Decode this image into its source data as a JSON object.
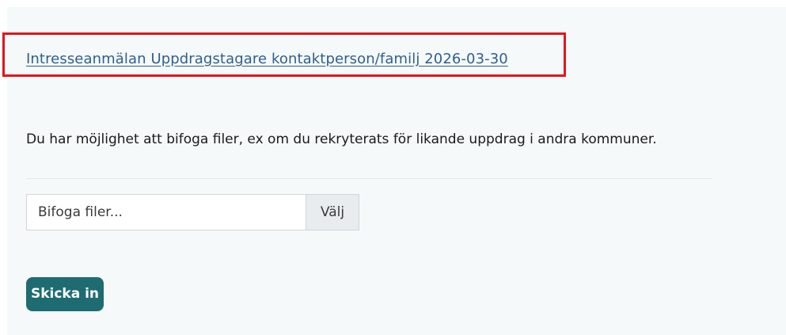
{
  "form": {
    "title_link": "Intresseanmälan Uppdragstagare kontaktperson/familj 2026-03-30",
    "info_text": "Du har möjlighet att bifoga filer, ex om du rekryterats för likande uppdrag i andra kommuner.",
    "file_input": {
      "placeholder": "Bifoga filer...",
      "button_label": "Välj"
    },
    "submit_label": "Skicka in"
  },
  "colors": {
    "highlight_border": "#e0161c",
    "link": "#2f5f8c",
    "submit_background": "#1f6b72",
    "panel_background": "#f5f9fa"
  }
}
